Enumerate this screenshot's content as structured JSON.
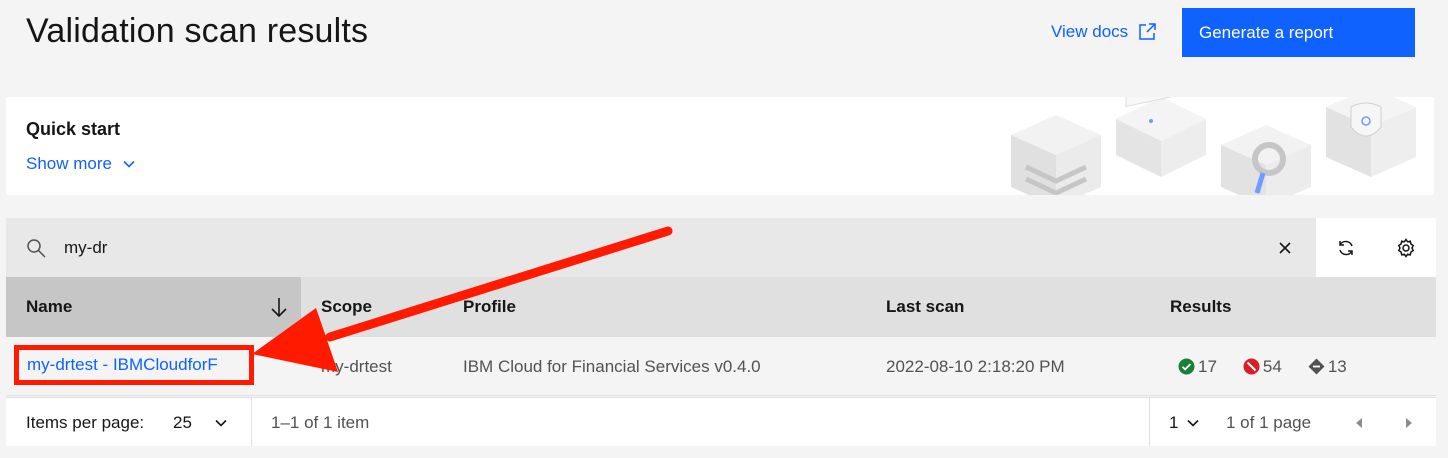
{
  "header": {
    "title": "Validation scan results",
    "view_docs_label": "View docs",
    "generate_report_label": "Generate a report"
  },
  "quick_start": {
    "title": "Quick start",
    "show_more_label": "Show more"
  },
  "toolbar": {
    "search_value": "my-dr"
  },
  "table": {
    "columns": [
      "Name",
      "Scope",
      "Profile",
      "Last scan",
      "Results"
    ],
    "rows": [
      {
        "name": "my-drtest - IBMCloudforF",
        "scope": "my-drtest",
        "profile": "IBM Cloud for Financial Services v0.4.0",
        "last_scan": "2022-08-10 2:18:20 PM",
        "results": {
          "passed": "17",
          "failed": "54",
          "unable": "13"
        }
      }
    ]
  },
  "pagination": {
    "items_per_page_label": "Items per page:",
    "items_per_page_value": "25",
    "range_text": "1–1 of 1 item",
    "page_value": "1",
    "page_total_text": "1 of 1 page"
  },
  "colors": {
    "accent": "#0f62fe",
    "annotation": "#ff1a00",
    "pass": "#198038",
    "fail": "#da1e28",
    "unable": "#525252"
  },
  "icons": [
    "launch-icon",
    "chevron-down-icon",
    "search-icon",
    "close-icon",
    "renew-icon",
    "settings-icon",
    "arrow-down-icon",
    "checkmark-filled-icon",
    "misuse-icon",
    "unknown-filled-icon",
    "caret-left-icon",
    "caret-right-icon"
  ]
}
